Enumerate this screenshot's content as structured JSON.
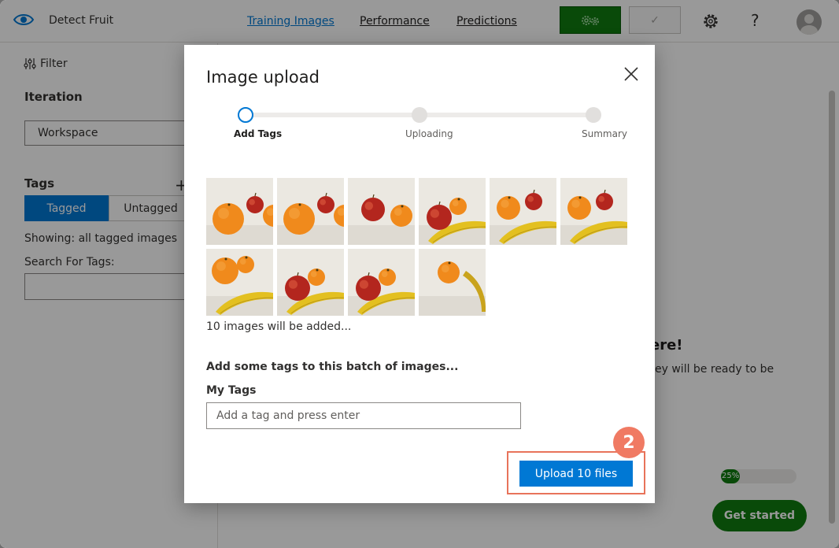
{
  "app": {
    "title": "Detect Fruit",
    "nav": [
      "Training Images",
      "Performance",
      "Predictions"
    ],
    "check_glyph": "✓",
    "help_glyph": "?"
  },
  "sidebar": {
    "filter_label": "Filter",
    "iteration_heading": "Iteration",
    "iteration_value": "Workspace",
    "tags_heading": "Tags",
    "add_tag_glyph": "+",
    "tagged_label": "Tagged",
    "untagged_label": "Untagged",
    "showing": "Showing: all tagged images",
    "search_label": "Search For Tags:"
  },
  "background": {
    "heading_partial": "ere!",
    "sub_partial": "ey will be ready to be",
    "progress_percent": 25,
    "progress_label": "25%",
    "get_started_label": "Get started"
  },
  "modal": {
    "title": "Image upload",
    "steps": [
      "Add Tags",
      "Uploading",
      "Summary"
    ],
    "current_step": 0,
    "images": [
      "orange-apple-orange",
      "orange-apple-orange",
      "apple-orange",
      "apple-orange-banana",
      "orange-apple-banana",
      "orange-apple-banana",
      "orange-orange-banana",
      "apple-orange-banana",
      "apple-orange-banana",
      "orange-banana"
    ],
    "images_count_text": "10 images will be added...",
    "batch_heading": "Add some tags to this batch of images...",
    "my_tags_label": "My Tags",
    "tag_placeholder": "Add a tag and press enter",
    "upload_label": "Upload 10 files"
  },
  "annotation": {
    "step_number": "2",
    "highlight_color": "#e8735a"
  },
  "colors": {
    "primary": "#0078d4",
    "train_green": "#107c10"
  }
}
